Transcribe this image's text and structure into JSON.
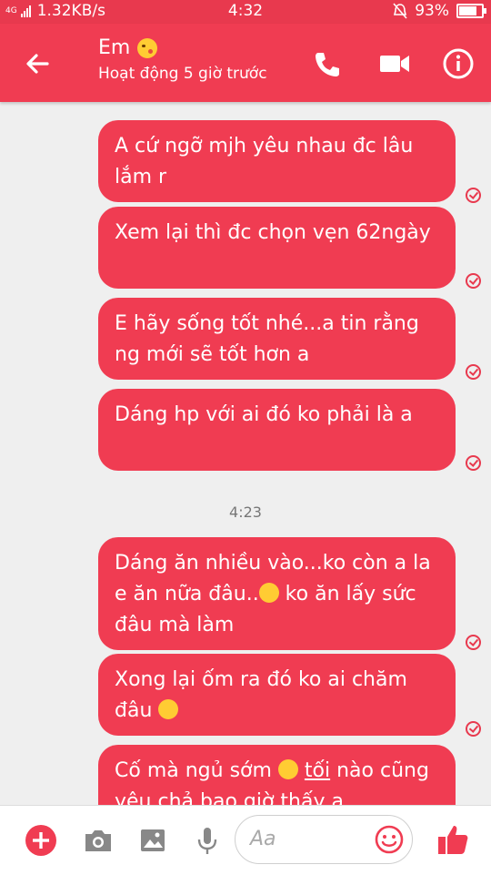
{
  "status_bar": {
    "network": "4G",
    "speed": "1.32KB/s",
    "time": "4:32",
    "battery_percent": "93%",
    "battery_level": 0.93
  },
  "header": {
    "contact_name": "Em",
    "status": "Hoạt động 5 giờ trước"
  },
  "messages": [
    {
      "text": "A cứ ngỡ mjh yêu nhau đc lâu lắm r"
    },
    {
      "text": "Xem lại thì đc chọn vẹn 62ngày"
    },
    {
      "text": "E hãy sống tốt nhé...a tin rằng ng mới sẽ tốt hơn a"
    },
    {
      "text": "Dáng hp với ai đó ko phải là a"
    }
  ],
  "timestamp_2": "4:23",
  "messages2": [
    {
      "text_a": "Dáng ăn nhiều vào...ko còn a la e ăn nữa đâu..",
      "text_b": " ko ăn lấy sức đâu mà làm"
    },
    {
      "text_a": "Xong lại ốm ra đó ko ai chăm đâu ",
      "text_b": ""
    },
    {
      "text_a": "Cố mà ngủ sớm ",
      "text_b": "tối",
      "text_c": " nào cũng yêu chả bao giờ thấy a"
    }
  ],
  "composer": {
    "placeholder": "Aa"
  },
  "colors": {
    "accent": "#f03c52"
  }
}
